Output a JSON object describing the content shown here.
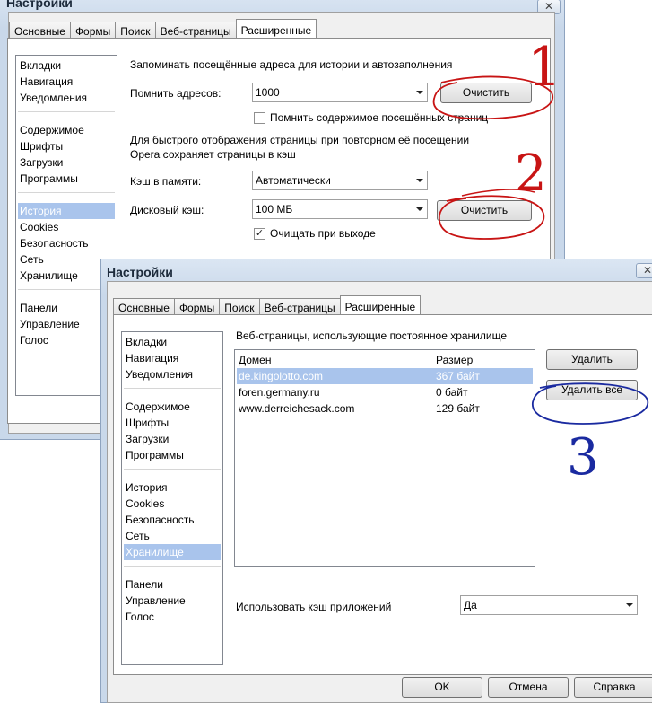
{
  "back": {
    "title": "Настройки",
    "close_icon": "close-icon",
    "tabs": [
      "Основные",
      "Формы",
      "Поиск",
      "Веб-страницы",
      "Расширенные"
    ],
    "sidebar": [
      "Вкладки",
      "Навигация",
      "Уведомления",
      "Содержимое",
      "Шрифты",
      "Загрузки",
      "Программы",
      "История",
      "Cookies",
      "Безопасность",
      "Сеть",
      "Хранилище",
      "Панели",
      "Управление",
      "Голос"
    ],
    "selected": "История",
    "history_heading": "Запоминать посещённые адреса для истории и автозаполнения",
    "remember_label": "Помнить адресов:",
    "remember_value": "1000",
    "clear1": "Очистить",
    "remember_contents": "Помнить содержимое посещённых страниц",
    "cache_text1": "Для быстрого отображения страницы при повторном её посещении",
    "cache_text2": "Opera сохраняет страницы в кэш",
    "mem_cache_label": "Кэш в памяти:",
    "mem_cache_value": "Автоматически",
    "disk_cache_label": "Дисковый кэш:",
    "disk_cache_value": "100 МБ",
    "clear2": "Очистить",
    "clear_on_exit": "Очищать при выходе",
    "clear_on_exit_checked": true
  },
  "front": {
    "title": "Настройки",
    "close_icon": "close-icon",
    "tabs": [
      "Основные",
      "Формы",
      "Поиск",
      "Веб-страницы",
      "Расширенные"
    ],
    "sidebar": [
      "Вкладки",
      "Навигация",
      "Уведомления",
      "Содержимое",
      "Шрифты",
      "Загрузки",
      "Программы",
      "История",
      "Cookies",
      "Безопасность",
      "Сеть",
      "Хранилище",
      "Панели",
      "Управление",
      "Голос"
    ],
    "selected": "Хранилище",
    "storage_heading": "Веб-страницы, использующие постоянное хранилище",
    "columns": [
      "Домен",
      "Размер"
    ],
    "rows": [
      [
        "de.kingolotto.com",
        "367 байт"
      ],
      [
        "foren.germany.ru",
        "0 байт"
      ],
      [
        "www.derreichesack.com",
        "129 байт"
      ]
    ],
    "delete": "Удалить",
    "delete_all": "Удалить все",
    "app_cache_label": "Использовать кэш приложений",
    "app_cache_value": "Да",
    "ok": "OK",
    "cancel": "Отмена",
    "help": "Справка"
  },
  "annotations": [
    "1",
    "2",
    "3"
  ],
  "colors": {
    "red_marker": "#c81414",
    "blue_marker": "#1a2aa0",
    "selection": "#a9c4ec"
  }
}
